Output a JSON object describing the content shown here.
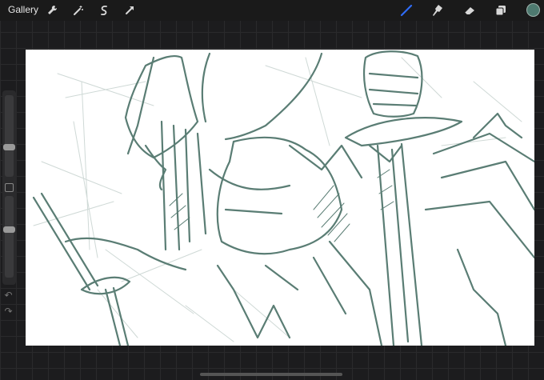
{
  "toolbar": {
    "gallery_label": "Gallery",
    "left_tools": [
      "wrench-icon",
      "magic-wand-icon",
      "selection-icon",
      "transform-arrow-icon"
    ],
    "right_tools": [
      "brush-icon",
      "smudge-icon",
      "eraser-icon",
      "layers-icon"
    ],
    "active_tool": "brush-icon",
    "current_color": "#4e7a70",
    "active_tool_color": "#2f6cf6"
  },
  "canvas": {
    "stroke_color": "#5a7d74",
    "background": "#ffffff"
  },
  "sidebar": {
    "brush_size_level": 0.35,
    "opacity_level": 0.6
  }
}
